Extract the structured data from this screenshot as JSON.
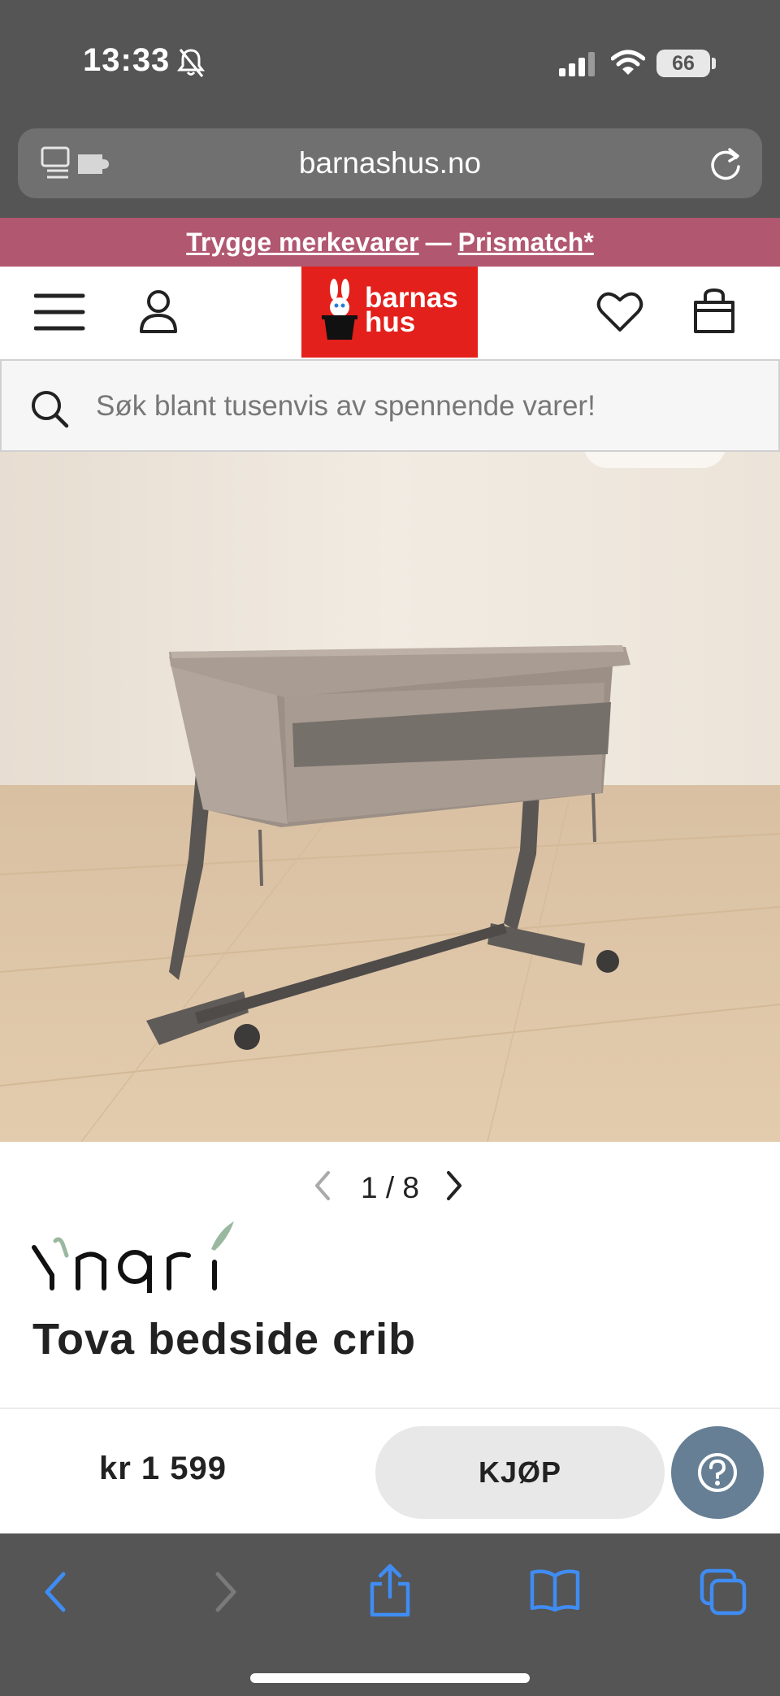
{
  "status_bar": {
    "time": "13:33",
    "battery": "66",
    "icons": [
      "bell-slash-icon",
      "signal-icon",
      "wifi-icon",
      "battery-icon"
    ]
  },
  "browser": {
    "url": "barnashus.no",
    "icons": [
      "reader-icon",
      "reload-icon"
    ]
  },
  "promo": {
    "link1": "Trygge merkevarer",
    "separator": "—",
    "link2": "Prismatch*",
    "color": "#b1576f"
  },
  "header": {
    "logo_line1": "barnas",
    "logo_line2": "hus",
    "logo_color": "#e3201b",
    "icons": [
      "menu-icon",
      "account-icon",
      "heart-icon",
      "bag-icon"
    ]
  },
  "search": {
    "placeholder": "Søk blant tusenvis av spennende varer!"
  },
  "product": {
    "image_description_icon": "crib-image",
    "pager_current": "1",
    "pager_total": "8",
    "pager_text": "1 / 8",
    "brand": "Yngri",
    "title": "Tova bedside crib"
  },
  "buy_bar": {
    "price": "kr 1 599",
    "buy_label": "KJØP",
    "help_icon": "question-icon",
    "help_color": "#667f94"
  },
  "toolbar": {
    "icons": [
      "back-icon",
      "forward-icon",
      "share-icon",
      "bookmarks-icon",
      "tabs-icon"
    ],
    "accent": "#3f8cf3"
  }
}
